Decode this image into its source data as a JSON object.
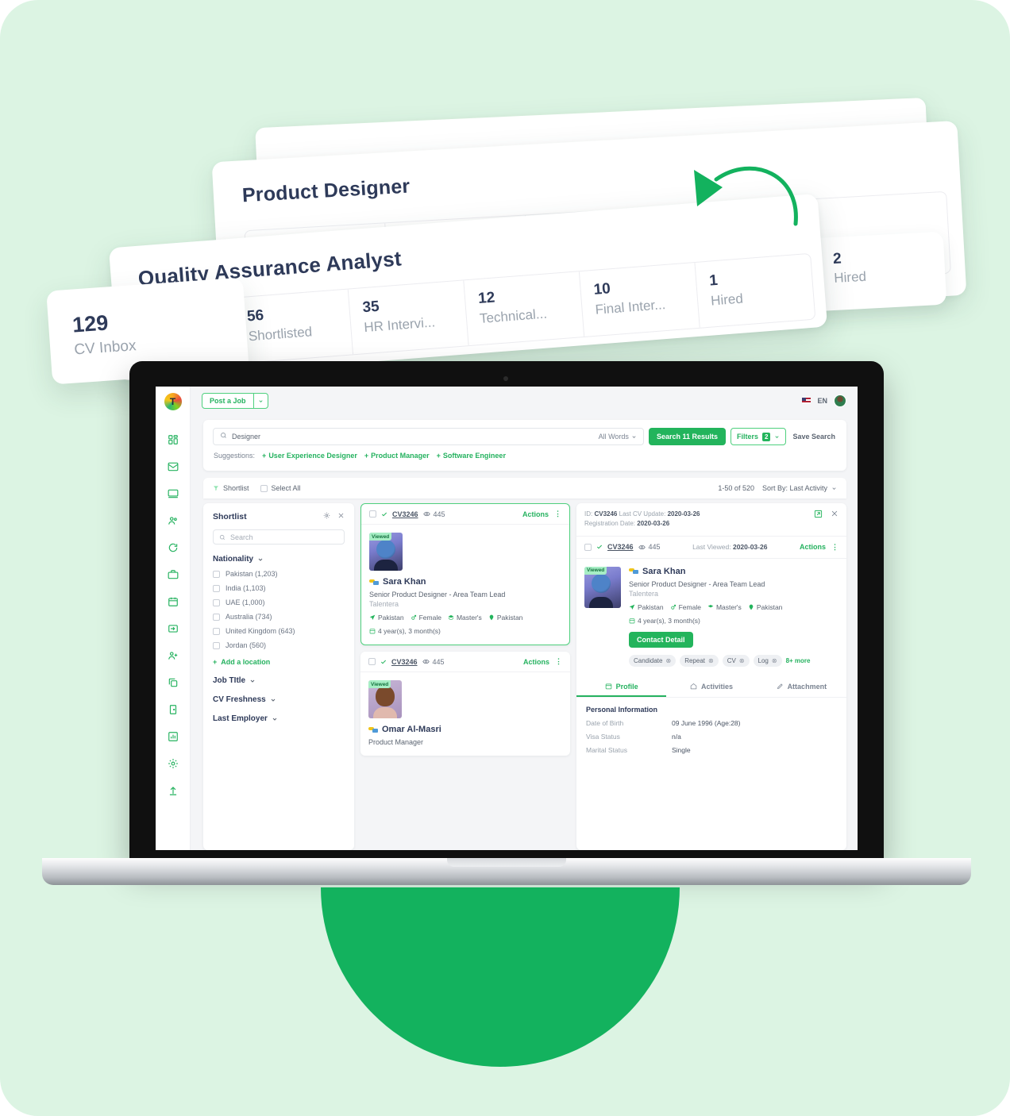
{
  "theme": {
    "bg_mint": "#dcf4e3",
    "green": "#13b25e",
    "accent_green": "#23b45c",
    "navy": "#2e3a59"
  },
  "floating_cards": {
    "product_designer": {
      "title": "Product Designer",
      "stats": []
    },
    "hired_tile": {
      "value": "2",
      "label": "Hired"
    },
    "qa_analyst": {
      "title": "Quality Assurance Analyst",
      "stats": [
        {
          "value": "56",
          "label": "Shortlisted"
        },
        {
          "value": "35",
          "label": "HR Intervi..."
        },
        {
          "value": "12",
          "label": "Technical..."
        },
        {
          "value": "10",
          "label": "Final Inter..."
        },
        {
          "value": "1",
          "label": "Hired"
        }
      ]
    },
    "cv_inbox": {
      "value": "129",
      "label": "CV Inbox"
    }
  },
  "app": {
    "logo_letter": "T",
    "rail_icons": [
      "dashboard-icon",
      "mail-icon",
      "monitor-icon",
      "people-icon",
      "refresh-icon",
      "briefcase-icon",
      "calendar-icon",
      "inbox-in-icon",
      "add-user-icon",
      "copy-icon",
      "door-icon",
      "chart-icon",
      "gear-icon",
      "upload-icon"
    ],
    "topbar": {
      "post_job_label": "Post a Job",
      "caret": "⌄",
      "language": "EN"
    },
    "search": {
      "value": "Designer",
      "placeholder": "Designer",
      "match_mode": "All Words",
      "search_button": "Search 11 Results",
      "filters_label": "Filters",
      "filters_count": "2",
      "save_search": "Save Search",
      "suggestions_label": "Suggestions:",
      "suggestions": [
        "User Experience Designer",
        "Product Manager",
        "Software Engineer"
      ]
    },
    "toolbar": {
      "shortlist_label": "Shortlist",
      "select_all_label": "Select All",
      "range": "1-50 of 520",
      "sort_label": "Sort By: Last Activity"
    },
    "shortlist_panel": {
      "title": "Shortlist",
      "search_placeholder": "Search",
      "facets": [
        {
          "name": "Nationality",
          "open": true,
          "options": [
            "Pakistan (1,203)",
            "India (1,103)",
            "UAE (1,000)",
            "Australia (734)",
            "United Kingdom (643)",
            "Jordan (560)"
          ],
          "add_label": "Add a location"
        },
        {
          "name": "Job TItle",
          "open": false,
          "options": []
        },
        {
          "name": "CV Freshness",
          "open": false,
          "options": []
        },
        {
          "name": "Last Employer",
          "open": false,
          "options": []
        }
      ]
    },
    "candidates": [
      {
        "cv_id": "CV3246",
        "views": "445",
        "actions_label": "Actions",
        "badge": "Viewed",
        "name": "Sara Khan",
        "role": "Senior Product Designer - Area Team Lead",
        "company": "Talentera",
        "meta": [
          "Pakistan",
          "Female",
          "Master's",
          "Pakistan"
        ],
        "experience": "4 year(s), 3 month(s)"
      },
      {
        "cv_id": "CV3246",
        "views": "445",
        "actions_label": "Actions",
        "badge": "Viewed",
        "name": "Omar Al-Masri",
        "role": "Product Manager",
        "company": "",
        "meta": [],
        "experience": ""
      }
    ],
    "detail": {
      "id_label": "ID:",
      "id_value": "CV3246",
      "last_update_label": "Last CV Update:",
      "last_update_value": "2020-03-26",
      "registration_label": "Registration Date:",
      "registration_value": "2020-03-26",
      "cv_id": "CV3246",
      "views": "445",
      "last_viewed_label": "Last Viewed:",
      "last_viewed_value": "2020-03-26",
      "actions_label": "Actions",
      "badge": "Viewed",
      "name": "Sara Khan",
      "role": "Senior Product Designer - Area Team Lead",
      "company": "Talentera",
      "meta": [
        "Pakistan",
        "Female",
        "Master's",
        "Pakistan"
      ],
      "experience": "4 year(s), 3 month(s)",
      "contact_button": "Contact Detail",
      "tags": [
        "Candidate",
        "Repeat",
        "CV",
        "Log"
      ],
      "more_tags": "8+ more",
      "tabs": [
        {
          "label": "Profile",
          "active": true
        },
        {
          "label": "Activities",
          "active": false
        },
        {
          "label": "Attachment",
          "active": false
        }
      ],
      "section_title": "Personal Information",
      "info": [
        {
          "key": "Date of Birth",
          "value": "09 June 1996 (Age:28)"
        },
        {
          "key": "Visa Status",
          "value": "n/a"
        },
        {
          "key": "Marital Status",
          "value": "Single"
        }
      ]
    }
  }
}
